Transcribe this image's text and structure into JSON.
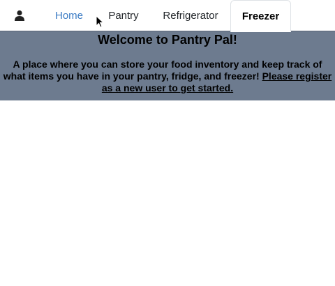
{
  "nav": {
    "user_icon": "user-icon",
    "links": [
      {
        "label": "Home",
        "active_color": "#3a7bc4"
      },
      {
        "label": "Pantry"
      },
      {
        "label": "Refrigerator"
      },
      {
        "label": "Freezer",
        "selected": true
      }
    ]
  },
  "banner": {
    "title": "Welcome to Pantry Pal!",
    "text": "A place where you can store your food inventory and keep track of what items you have in your pantry, fridge, and freezer!",
    "link": "Please register as a new user to get started.",
    "background": "#6d7b8f"
  }
}
